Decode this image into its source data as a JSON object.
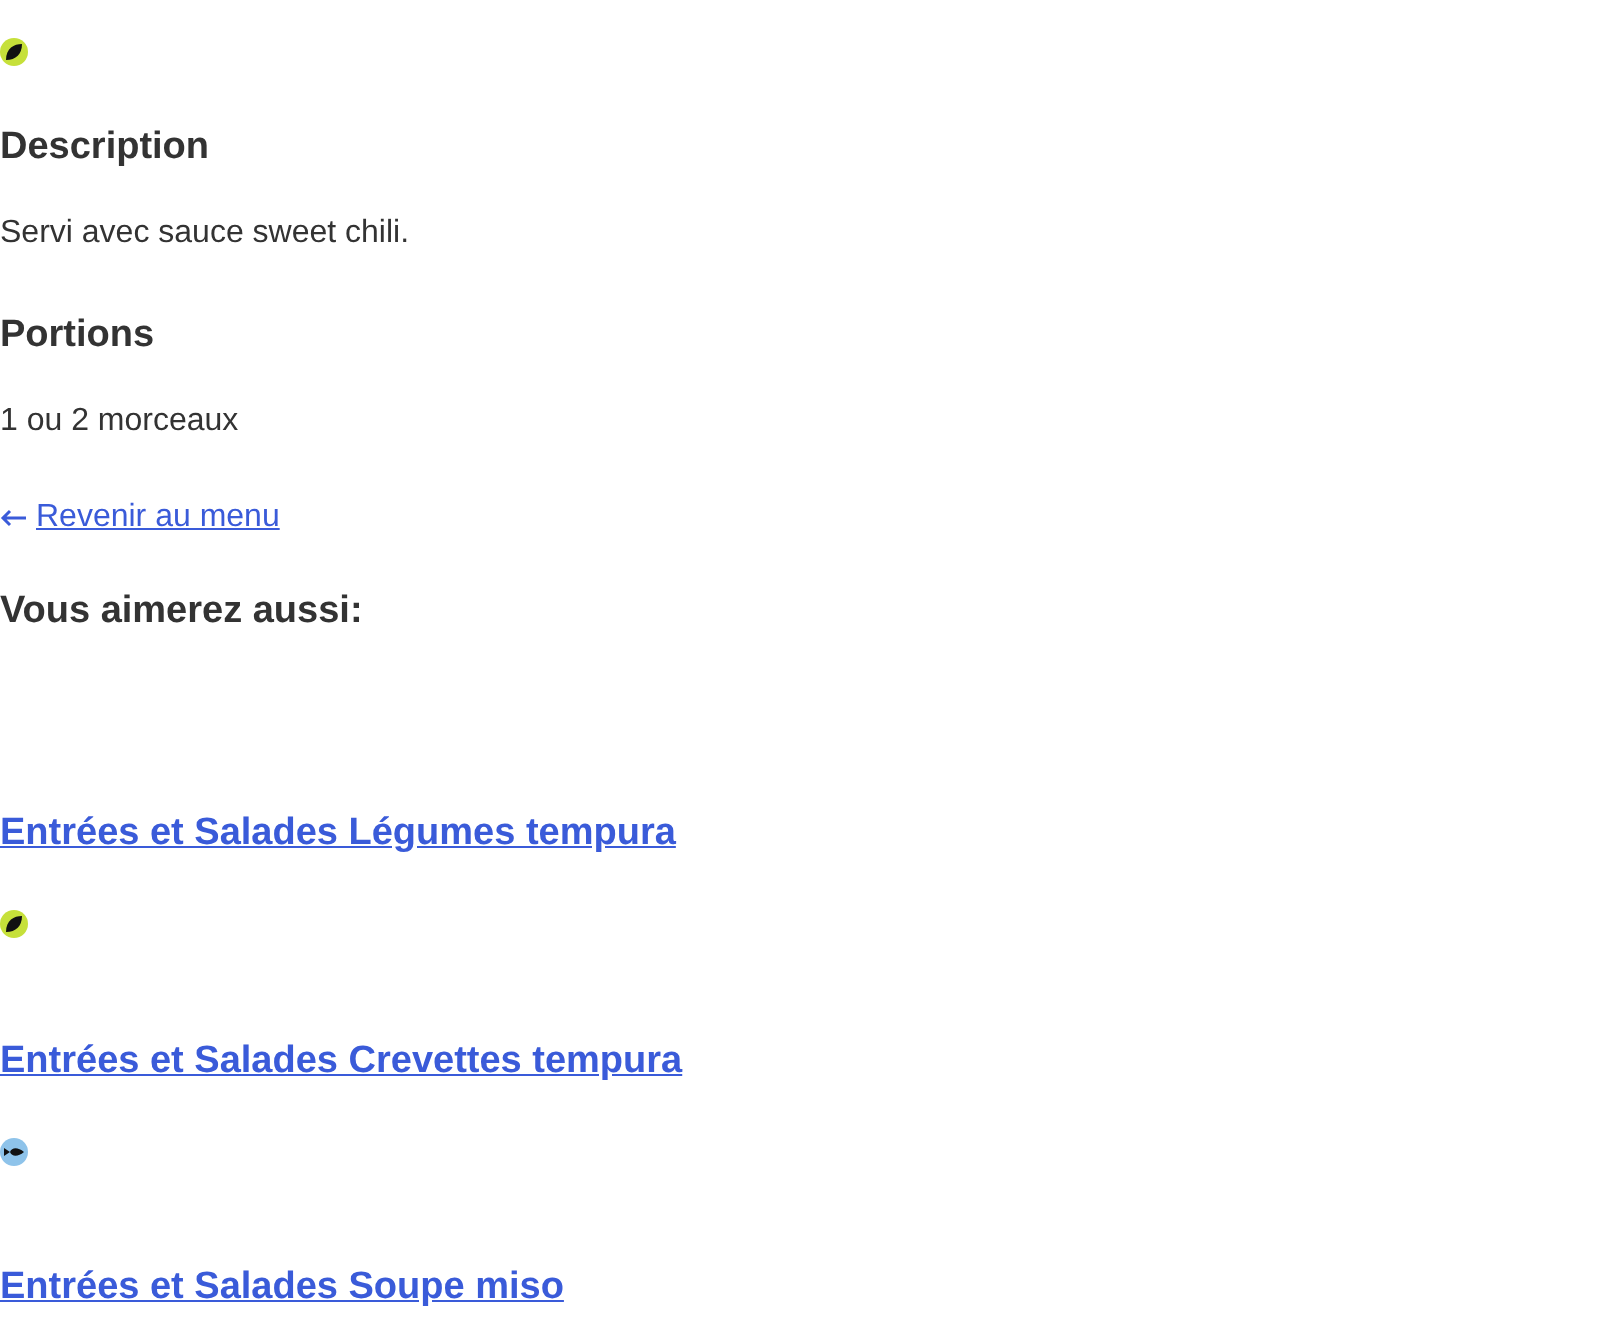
{
  "product": {
    "kind": "vegetarian"
  },
  "sections": [
    {
      "heading": "Description",
      "text": "Servi avec sauce sweet chili."
    },
    {
      "heading": "Portions",
      "text": "1 ou 2 morceaux"
    }
  ],
  "back_link": {
    "label": "Revenir au menu"
  },
  "related": {
    "heading": "Vous aimerez aussi:",
    "items": [
      {
        "title": "Entrées et Salades Légumes tempura",
        "kind": "vegetarian"
      },
      {
        "title": "Entrées et Salades Crevettes tempura",
        "kind": "seafood"
      },
      {
        "title": "Entrées et Salades Soupe miso"
      }
    ]
  }
}
